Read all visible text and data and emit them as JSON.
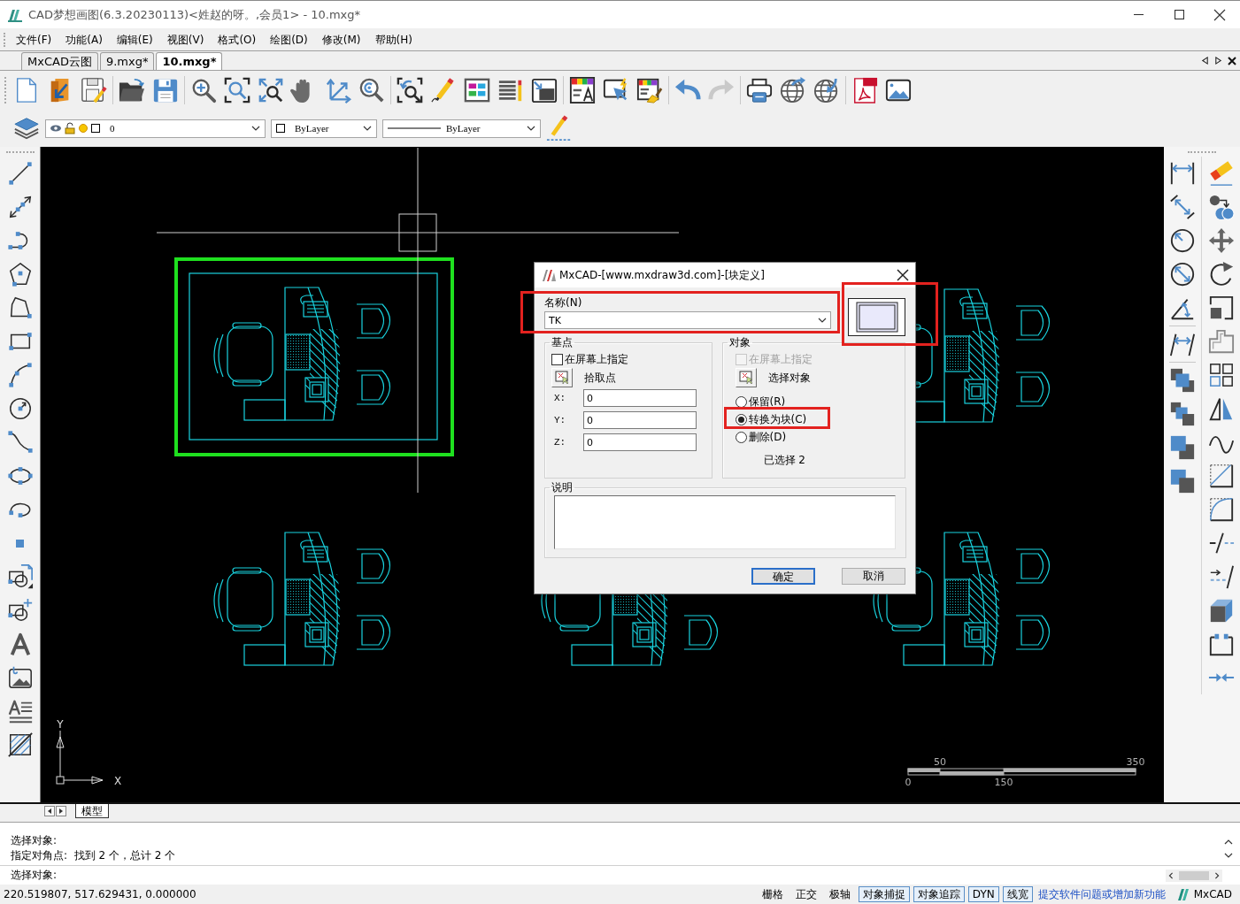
{
  "window": {
    "title": "CAD梦想画图(6.3.20230113)<姓赵的呀。,会员1> - 10.mxg*"
  },
  "menu": [
    "文件(F)",
    "功能(A)",
    "编辑(E)",
    "视图(V)",
    "格式(O)",
    "绘图(D)",
    "修改(M)",
    "帮助(H)"
  ],
  "document_tabs": [
    {
      "label": "MxCAD云图",
      "selected": false
    },
    {
      "label": "9.mxg*",
      "selected": false
    },
    {
      "label": "10.mxg*",
      "selected": true
    }
  ],
  "properties_bar": {
    "layer": "0",
    "color_setting": "ByLayer",
    "linetype": "ByLayer"
  },
  "drawing": {
    "ucs": {
      "y_label": "Y",
      "x_label": "X"
    },
    "scale_bar": {
      "top_labels": [
        "50",
        "350"
      ],
      "bottom_labels": [
        "0",
        "150"
      ]
    }
  },
  "dialog": {
    "title": "MxCAD-[www.mxdraw3d.com]-[块定义]",
    "name": {
      "label": "名称(N)",
      "value": "TK"
    },
    "base_point": {
      "title": "基点",
      "on_screen": {
        "label": "在屏幕上指定",
        "checked": false,
        "disabled": false
      },
      "pick_label": "拾取点",
      "coords": [
        {
          "label": "X:",
          "value": "0"
        },
        {
          "label": "Y:",
          "value": "0"
        },
        {
          "label": "Z:",
          "value": "0"
        }
      ]
    },
    "objects": {
      "title": "对象",
      "on_screen": {
        "label": "在屏幕上指定",
        "checked": false,
        "disabled": true
      },
      "select_label": "选择对象",
      "options": [
        {
          "label": "保留(R)",
          "selected": false
        },
        {
          "label": "转换为块(C)",
          "selected": true
        },
        {
          "label": "删除(D)",
          "selected": false
        }
      ],
      "count": "已选择 2"
    },
    "description": {
      "title": "说明"
    },
    "buttons": [
      {
        "label": "确定",
        "default": true
      },
      {
        "label": "取消",
        "default": false
      }
    ]
  },
  "layout_tabs": [
    {
      "label": "模型",
      "selected": true
    }
  ],
  "command_line": {
    "history": [
      "选择对象:",
      "指定对角点:  找到 2 个，总计 2 个"
    ],
    "prompt": "选择对象:"
  },
  "status_bar": {
    "coordinates": "220.519807, 517.629431, 0.000000",
    "toggles": [
      {
        "label": "栅格",
        "on": false
      },
      {
        "label": "正交",
        "on": false
      },
      {
        "label": "极轴",
        "on": false
      },
      {
        "label": "对象捕捉",
        "on": true
      },
      {
        "label": "对象追踪",
        "on": true
      },
      {
        "label": "DYN",
        "on": true
      },
      {
        "label": "线宽",
        "on": true
      }
    ],
    "link": "提交软件问题或增加新功能",
    "brand": "MxCAD"
  }
}
